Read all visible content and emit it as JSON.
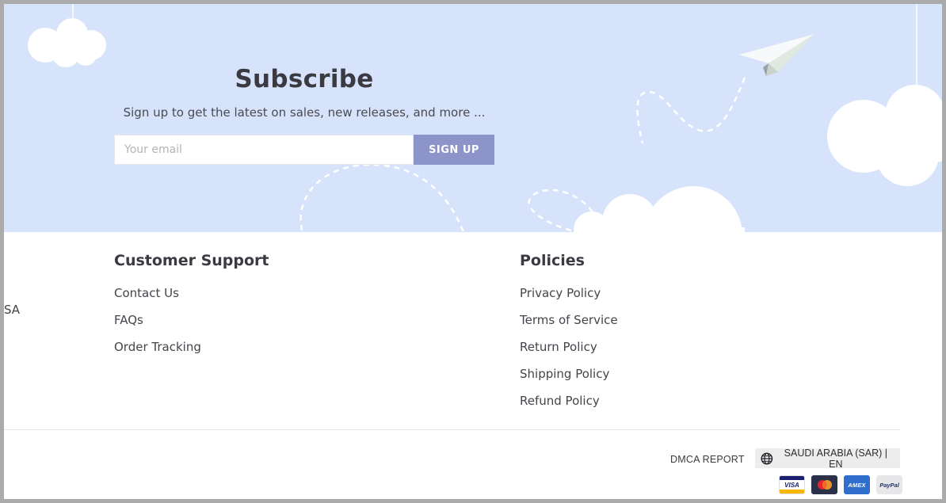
{
  "subscribe": {
    "title": "Subscribe",
    "subtitle": "Sign up to get the latest on sales, new releases, and more ...",
    "email_placeholder": "Your email",
    "email_value": "",
    "signup_label": "SIGN UP"
  },
  "footer": {
    "cut_off_text": "SA",
    "customer_support": {
      "title": "Customer Support",
      "links": [
        "Contact Us",
        "FAQs",
        "Order Tracking"
      ]
    },
    "policies": {
      "title": "Policies",
      "links": [
        "Privacy Policy",
        "Terms of Service",
        "Return Policy",
        "Shipping Policy",
        "Refund Policy"
      ]
    }
  },
  "bottom_bar": {
    "dmca_label": "DMCA REPORT",
    "locale_label": "SAUDI ARABIA (SAR) | EN",
    "locale_icon": "globe-icon",
    "payment_methods": [
      "VISA",
      "mastercard",
      "AMEX",
      "PayPal"
    ]
  },
  "colors": {
    "banner_bg": "#d6e3fb",
    "signup_button": "#8c94c9",
    "text_dark": "#3b3a42"
  }
}
